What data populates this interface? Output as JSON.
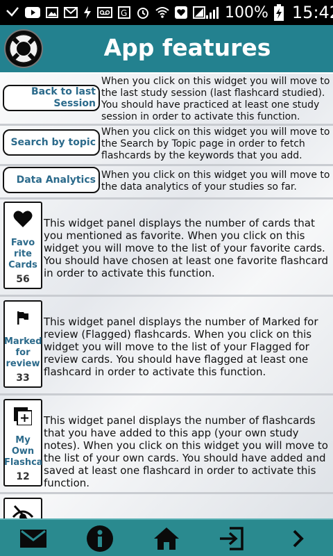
{
  "status_bar": {
    "battery_percent": "100%",
    "time": "15:42"
  },
  "header": {
    "title": "App features"
  },
  "features": [
    {
      "label": "Back to last Session",
      "description": "When you click on this widget you will move to the last study session (last flashcard studied). You should have practiced at least one study session in order to activate this function."
    },
    {
      "label": "Search by topic",
      "description": "When you click on this widget you will move to the Search by Topic page in order to fetch flashcards by the keywords that you add."
    },
    {
      "label": "Data Analytics",
      "description": "When you click on this widget you will move to the data analytics of your studies so far."
    }
  ],
  "panels": [
    {
      "label": "Favo rite Cards",
      "count": "56",
      "icon": "heart-icon",
      "description": "This widget panel displays the number of cards that you mentioned as favorite. When you click on this widget you will move to the list of your favorite cards. You should have chosen at least one favorite flashcard in order to activate this function."
    },
    {
      "label": "Marked for review",
      "count": "33",
      "icon": "flag-icon",
      "description": "This widget panel displays the number of Marked for review (Flagged) flashcards. When you click on this widget you will move to the list of your Flagged for review cards. You should have flagged at least one flashcard in order to activate this function."
    },
    {
      "label": "My Own Flashcards",
      "count": "12",
      "icon": "add-box-icon",
      "description": "This widget panel displays the number of flashcards that you have added to this app (your own study notes). When you click on this widget you will move to the list of your own cards. You should have added and saved at least one flashcard in order to activate this function."
    }
  ],
  "colors": {
    "header": "#23818f",
    "bottom_bar": "#2a8a8f",
    "label_blue": "#2b6a8b"
  }
}
